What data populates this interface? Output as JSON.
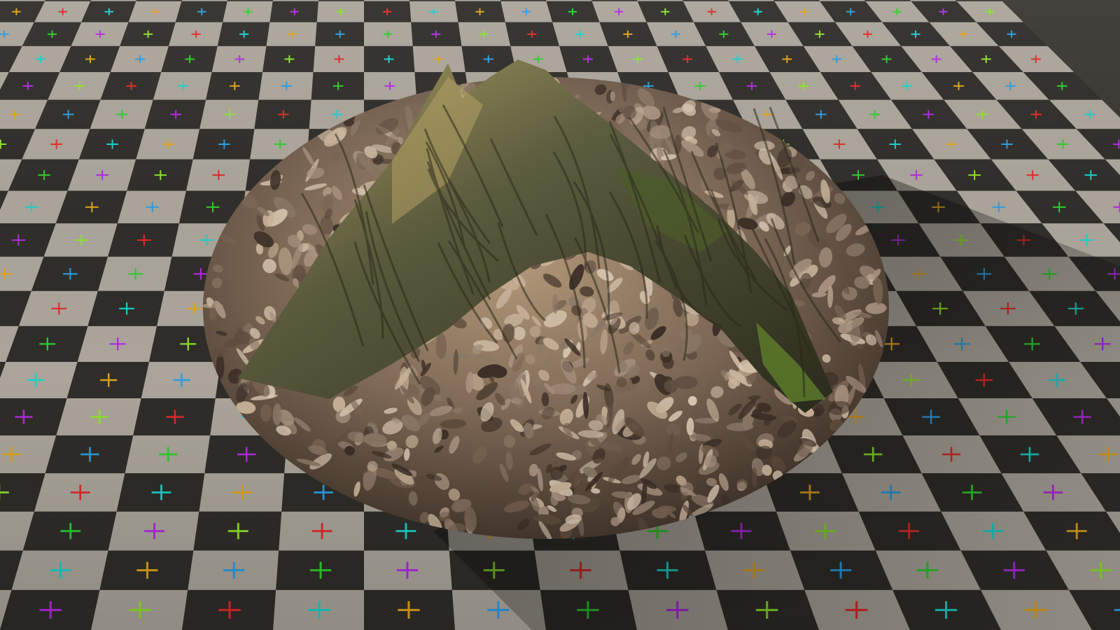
{
  "scene": {
    "floor": {
      "tile_light": "#aaa49a",
      "tile_dark": "#2f2d29",
      "marker_colors": [
        "#2ecc2e",
        "#e0a21c",
        "#e02a2a",
        "#b02ae0",
        "#2a9ce0",
        "#1ccfc9",
        "#8ee02a"
      ]
    },
    "object": {
      "subject": "tree-stump",
      "ground_cover": "dry-leaves",
      "bark_color": "#5a5a3c",
      "moss_color": "#5c7a2a",
      "leaf_color": "#8a7866"
    },
    "lighting": {
      "sun_color": "#ffd9a0",
      "shadow_color": "#000000"
    }
  }
}
